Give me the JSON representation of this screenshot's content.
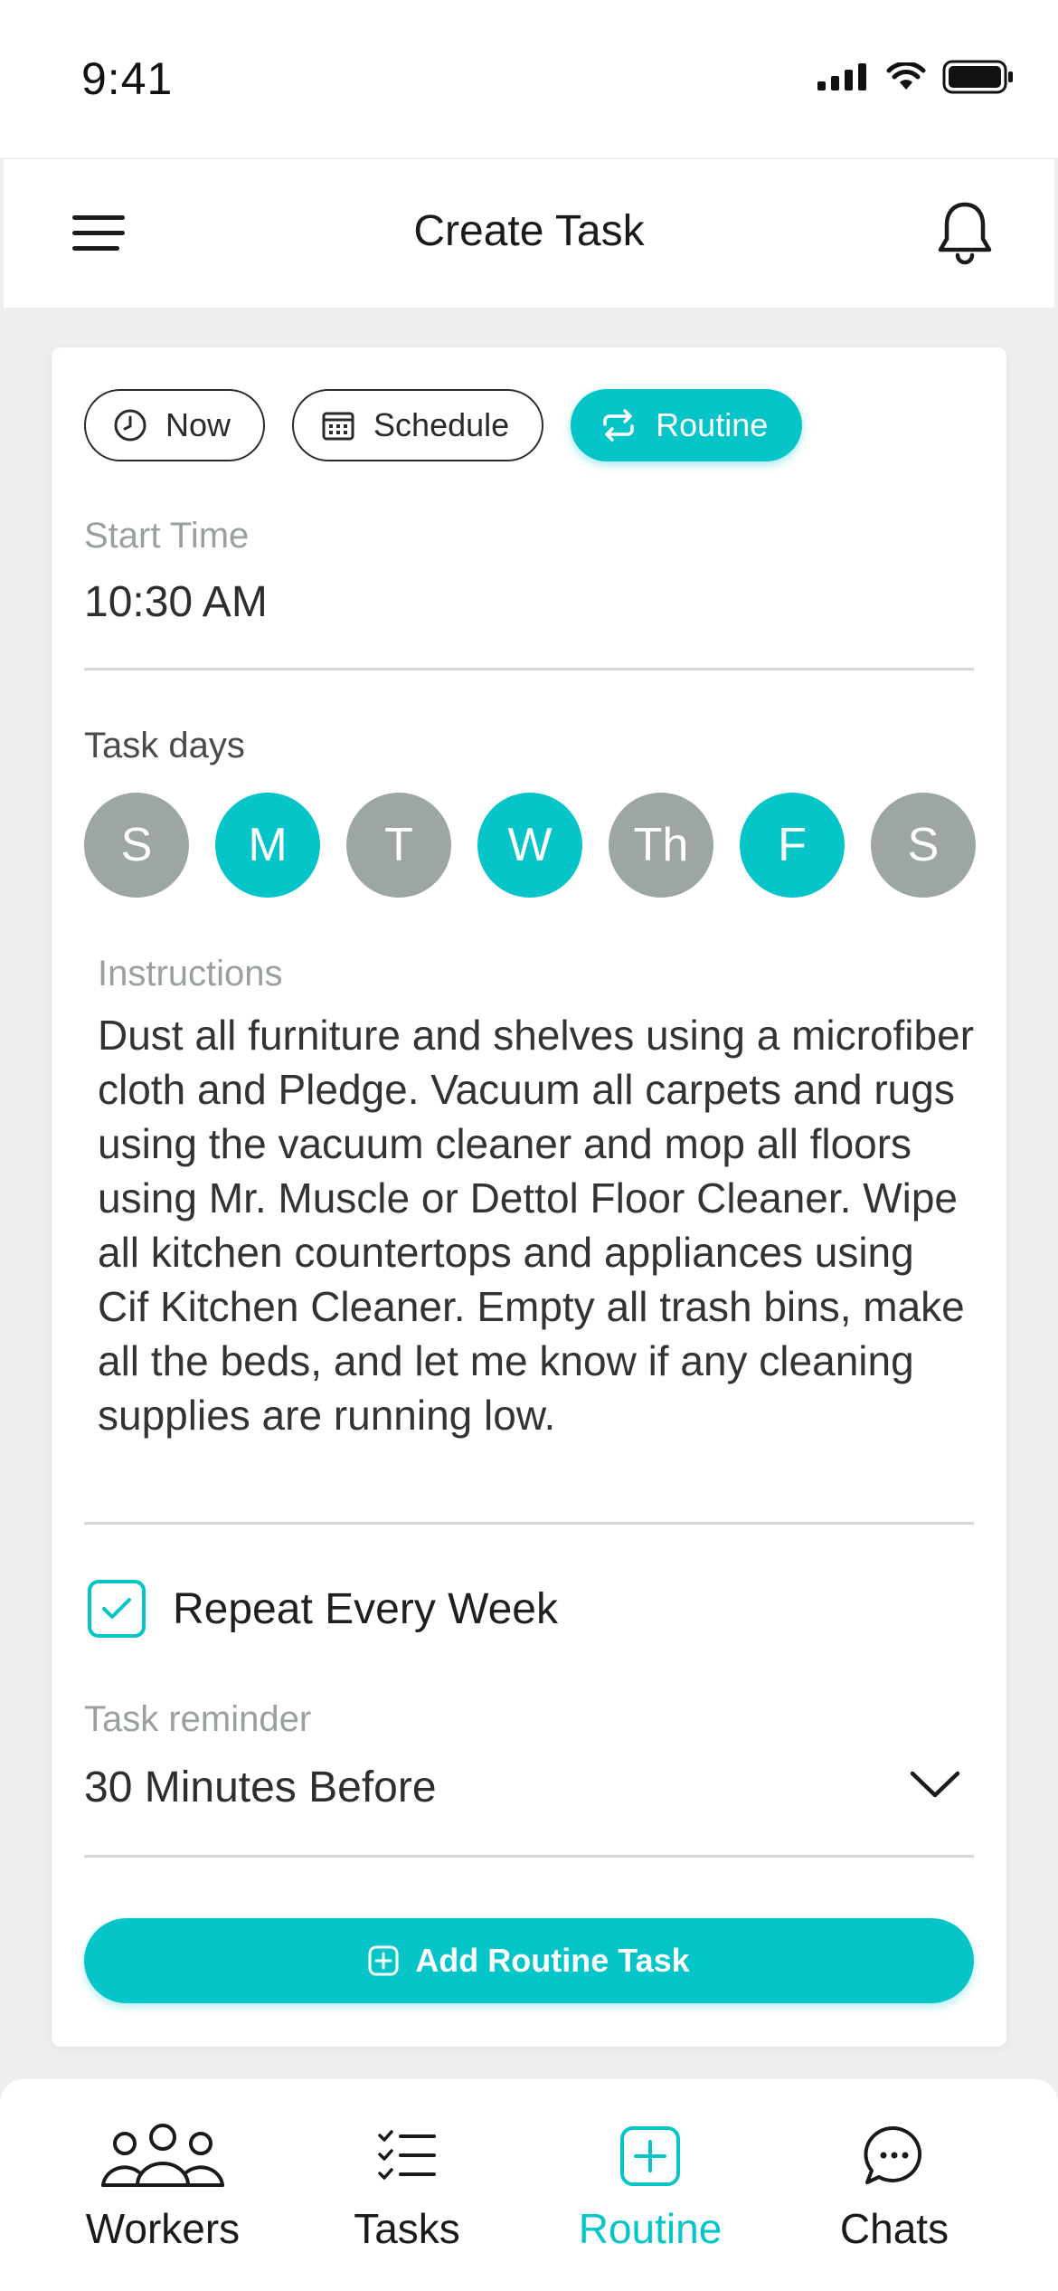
{
  "status_bar": {
    "time": "9:41"
  },
  "header": {
    "title": "Create Task"
  },
  "mode_tabs": [
    {
      "label": "Now",
      "icon": "clock-icon",
      "active": false
    },
    {
      "label": "Schedule",
      "icon": "calendar-icon",
      "active": false
    },
    {
      "label": "Routine",
      "icon": "repeat-icon",
      "active": true
    }
  ],
  "start_time": {
    "label": "Start Time",
    "value": "10:30 AM"
  },
  "task_days": {
    "label": "Task days",
    "days": [
      {
        "label": "S",
        "selected": false
      },
      {
        "label": "M",
        "selected": true
      },
      {
        "label": "T",
        "selected": false
      },
      {
        "label": "W",
        "selected": true
      },
      {
        "label": "Th",
        "selected": false
      },
      {
        "label": "F",
        "selected": true
      },
      {
        "label": "S",
        "selected": false
      }
    ]
  },
  "instructions": {
    "label": "Instructions",
    "value": "Dust all furniture and shelves using a microfiber cloth and Pledge. Vacuum all carpets and rugs using the vacuum cleaner and mop all floors using Mr. Muscle or Dettol Floor Cleaner. Wipe all kitchen countertops and appliances using Cif Kitchen Cleaner. Empty all trash bins, make all the beds, and let me know if any cleaning supplies are running low."
  },
  "repeat": {
    "label": "Repeat Every Week",
    "checked": true
  },
  "reminder": {
    "label": "Task reminder",
    "value": "30 Minutes Before"
  },
  "submit": {
    "label": "Add Routine Task",
    "icon": "plus-square-icon"
  },
  "bottom_nav": [
    {
      "label": "Workers",
      "icon": "users-icon",
      "active": false
    },
    {
      "label": "Tasks",
      "icon": "checklist-icon",
      "active": false
    },
    {
      "label": "Routine",
      "icon": "plus-square-icon",
      "active": true
    },
    {
      "label": "Chats",
      "icon": "chat-bubble-icon",
      "active": false
    }
  ],
  "colors": {
    "accent": "#06c5c9",
    "inactive_day": "#9ea5a5",
    "background": "#edeeee"
  }
}
